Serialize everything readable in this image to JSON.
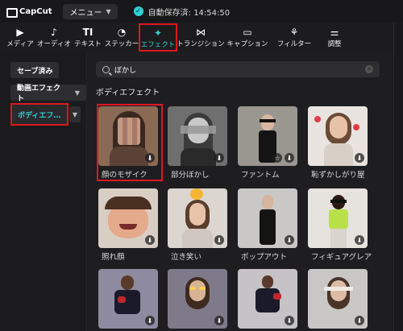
{
  "topbar": {
    "logo": "CapCut",
    "menu_label": "メニュー",
    "autosave_text": "自動保存済: 14:54:50"
  },
  "toolbar": {
    "items": [
      {
        "label": "メディア",
        "icon": "media-icon",
        "glyph": "▶"
      },
      {
        "label": "オーディオ",
        "icon": "audio-icon",
        "glyph": "♪"
      },
      {
        "label": "テキスト",
        "icon": "text-icon",
        "glyph": "TI"
      },
      {
        "label": "ステッカー",
        "icon": "sticker-icon",
        "glyph": "◔"
      },
      {
        "label": "エフェクト",
        "icon": "effect-icon",
        "glyph": "✦",
        "active": true
      },
      {
        "label": "トランジション",
        "icon": "transition-icon",
        "glyph": "⋈"
      },
      {
        "label": "キャプション",
        "icon": "caption-icon",
        "glyph": "▭"
      },
      {
        "label": "フィルター",
        "icon": "filter-icon",
        "glyph": "⚘"
      },
      {
        "label": "調整",
        "icon": "adjust-icon",
        "glyph": "⚌"
      }
    ]
  },
  "sidebar": {
    "saved": "セーブ済み",
    "video_effects": "動画エフェクト",
    "body_effects": "ボディエフ…"
  },
  "search": {
    "value": "ぼかし"
  },
  "section_title": "ボディエフェクト",
  "effects": [
    {
      "label": "顔のモザイク",
      "bg": "#8a6a55"
    },
    {
      "label": "部分ぼかし",
      "bg": "#6f6f6f"
    },
    {
      "label": "ファントム",
      "bg": "#9a9690"
    },
    {
      "label": "恥ずかしがり屋",
      "bg": "#e9e4e0"
    },
    {
      "label": "照れ顔",
      "bg": "#d9cec4"
    },
    {
      "label": "泣き笑い",
      "bg": "#dcd6d1"
    },
    {
      "label": "ポップアウト",
      "bg": "#c9c8c6"
    },
    {
      "label": "フィギュアグレア",
      "bg": "#e6e3df"
    },
    {
      "label": "",
      "bg": "#8e8aa0"
    },
    {
      "label": "",
      "bg": "#7e7a8a"
    },
    {
      "label": "",
      "bg": "#c6c2c5"
    },
    {
      "label": "",
      "bg": "#c9c7c5"
    }
  ],
  "colors": {
    "accent": "#36d1d9",
    "highlight": "#e0161f"
  }
}
